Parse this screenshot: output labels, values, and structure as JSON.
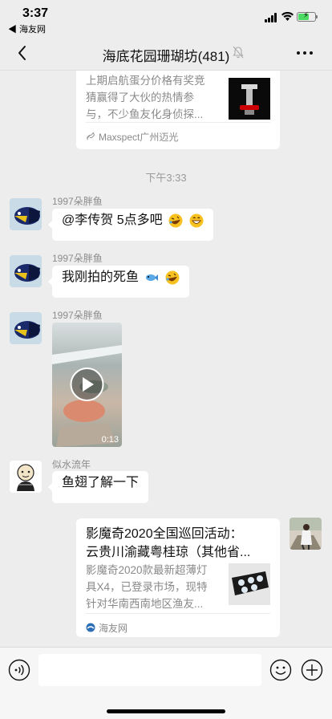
{
  "status_bar": {
    "time": "3:37",
    "back_app": "◀ 海友网"
  },
  "nav": {
    "title": "海底花园珊瑚坊(481)",
    "back_icon": "chevron-left-icon",
    "muted_icon": "bell-off-icon",
    "more_icon": "more-icon"
  },
  "top_card": {
    "desc": [
      "上期启航蛋分价格有奖竞",
      "猜赢得了大伙的热情参",
      "与，不少鱼友化身侦探..."
    ],
    "source": "Maxspect广州迈光"
  },
  "timestamp": "下午3:33",
  "messages": [
    {
      "sender": "1997朵胖鱼",
      "text": "@李传贺 5点多吧",
      "emojis": [
        "rofl-emoji",
        "grin-emoji"
      ]
    },
    {
      "sender": "1997朵胖鱼",
      "text": "我刚拍的死鱼",
      "emojis": [
        "fish-emoji",
        "rofl-emoji"
      ]
    },
    {
      "sender": "1997朵胖鱼",
      "video_duration": "0:13"
    },
    {
      "sender": "似水流年",
      "text": "鱼翅了解一下"
    }
  ],
  "bottom_card": {
    "title": [
      "影魔奇2020全国巡回活动：",
      "云贵川渝藏粤桂琼（其他省..."
    ],
    "desc": [
      "影魔奇2020款最新超薄灯",
      "具X4，已登录市场，现特",
      "针对华南西南地区渔友..."
    ],
    "source": "海友网"
  },
  "input_bar": {
    "voice_icon": "voice-icon",
    "emoji_icon": "emoji-icon",
    "plus_icon": "plus-icon"
  }
}
